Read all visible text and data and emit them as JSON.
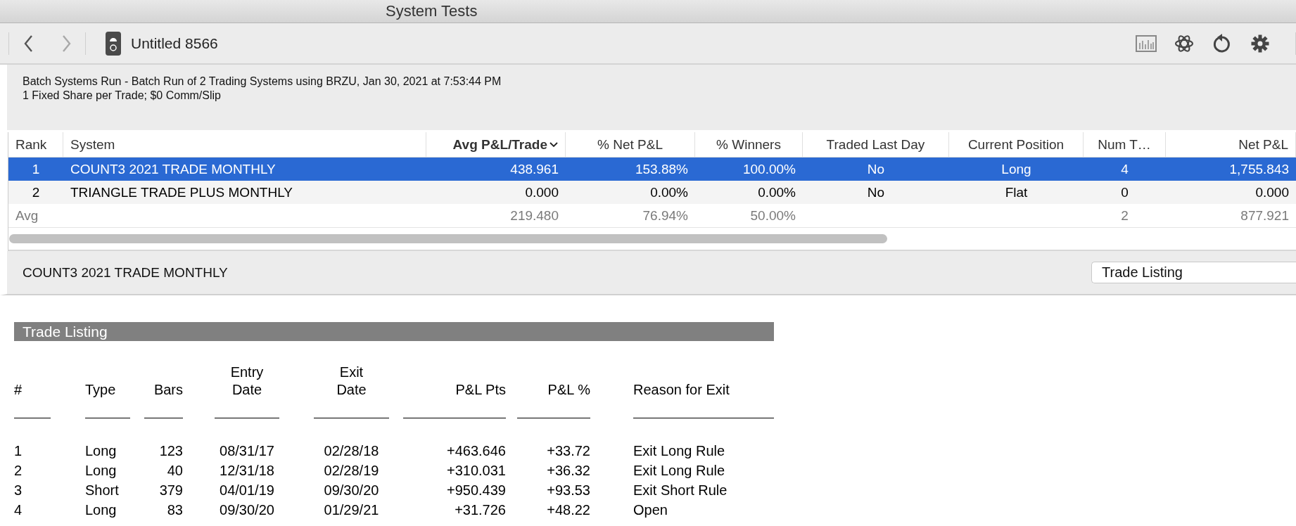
{
  "window": {
    "title": "System Tests"
  },
  "toolbar": {
    "nav": [
      {
        "kind": "back",
        "disabled": false
      },
      {
        "kind": "forward",
        "disabled": true
      }
    ],
    "document_title": "Untitled 8566"
  },
  "run_info": [
    "Batch Systems Run - Batch Run of 2 Trading Systems using BRZU, Jan 30, 2021 at 7:53:44 PM",
    "1 Fixed Share per Trade; $0 Comm/Slip"
  ],
  "results_table": {
    "columns": [
      {
        "label": "Rank",
        "sorted": false
      },
      {
        "label": "System",
        "sorted": false
      },
      {
        "label": "Avg P&L/Trade",
        "sorted": true
      },
      {
        "label": "% Net P&L",
        "sorted": false
      },
      {
        "label": "% Winners",
        "sorted": false
      },
      {
        "label": "Traded Last Day",
        "sorted": false
      },
      {
        "label": "Current Position",
        "sorted": false
      },
      {
        "label": "Num T…",
        "sorted": false
      },
      {
        "label": "Net P&L",
        "sorted": false
      }
    ],
    "rows": [
      {
        "selected": true,
        "cells": [
          "1",
          "COUNT3 2021 TRADE MONTHLY",
          "438.961",
          "153.88%",
          "100.00%",
          "No",
          "Long",
          "4",
          "1,755.843"
        ]
      },
      {
        "selected": false,
        "cells": [
          "2",
          "TRIANGLE TRADE PLUS MONTHLY",
          "0.000",
          "0.00%",
          "0.00%",
          "No",
          "Flat",
          "0",
          "0.000"
        ]
      }
    ],
    "average_row": {
      "rank": "Avg",
      "avg_pnl_per_trade": "219.480",
      "pct_net_pnl": "76.94%",
      "pct_winners": "50.00%",
      "num_trades": "2",
      "net_pnl": "877.921"
    }
  },
  "detail": {
    "system": "COUNT3 2021 TRADE MONTHLY",
    "view": "Trade Listing"
  },
  "trade_listing": {
    "title": "Trade Listing",
    "columns": [
      "#",
      "Type",
      "Bars",
      "Entry\nDate",
      "Exit\nDate",
      "P&L Pts",
      "P&L %",
      "Reason for Exit"
    ],
    "rows": [
      [
        "1",
        "Long",
        "123",
        "08/31/17",
        "02/28/18",
        "+463.646",
        "+33.72",
        "Exit Long Rule"
      ],
      [
        "2",
        "Long",
        "40",
        "12/31/18",
        "02/28/19",
        "+310.031",
        "+36.32",
        "Exit Long Rule"
      ],
      [
        "3",
        "Short",
        "379",
        "04/01/19",
        "09/30/20",
        "+950.439",
        "+93.53",
        "Exit Short Rule"
      ],
      [
        "4",
        "Long",
        "83",
        "09/30/20",
        "01/29/21",
        "+31.726",
        "+48.22",
        "Open"
      ]
    ]
  }
}
